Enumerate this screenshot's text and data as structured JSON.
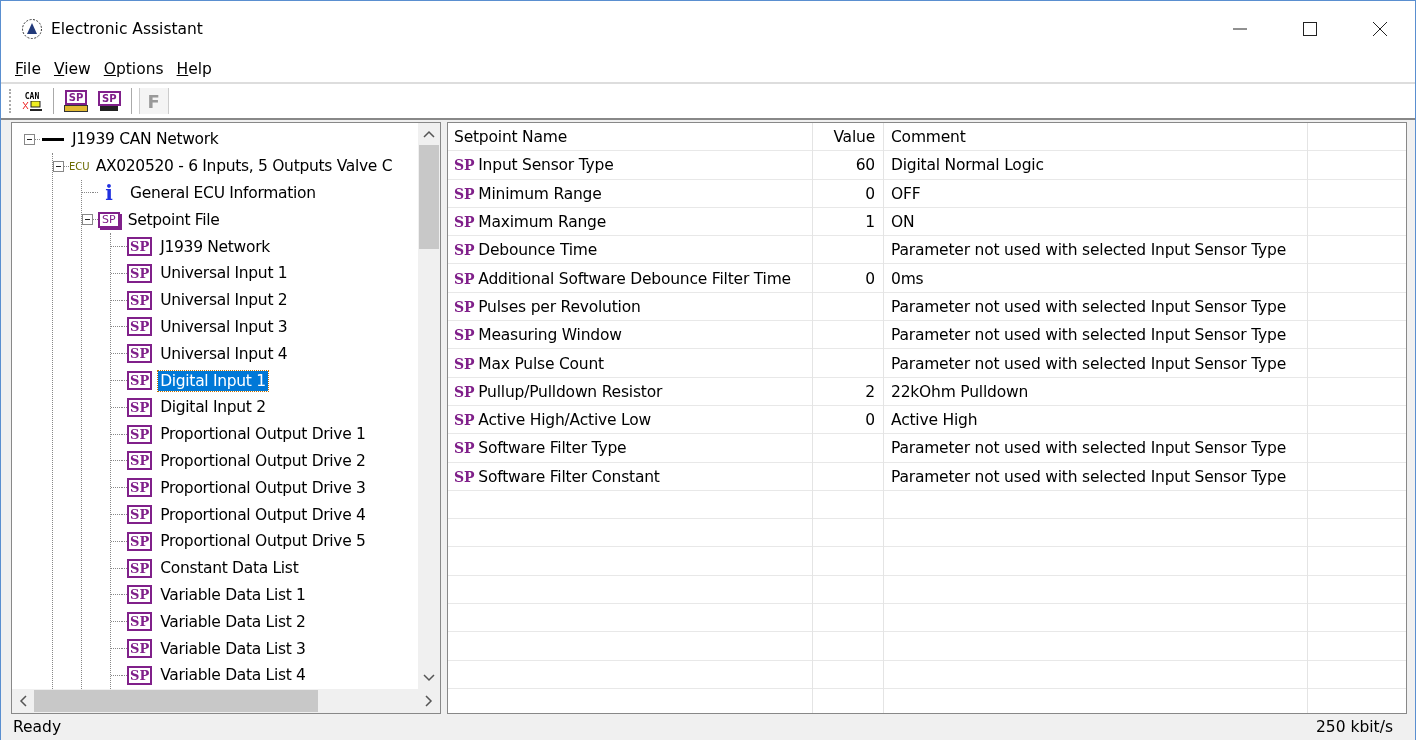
{
  "window": {
    "title": "Electronic Assistant"
  },
  "menu": [
    {
      "label": "File"
    },
    {
      "label": "View"
    },
    {
      "label": "Options"
    },
    {
      "label": "Help"
    }
  ],
  "toolbar": [
    {
      "kind": "can",
      "badge": "CAN"
    },
    {
      "kind": "open",
      "badge": "SP"
    },
    {
      "kind": "save",
      "badge": "SP"
    },
    {
      "kind": "text",
      "label": "F",
      "disabled": true
    }
  ],
  "tree": [
    {
      "label": "J1939 CAN Network",
      "kind": "network",
      "expanded": true,
      "selected": false,
      "children": [
        {
          "label": "AX020520 - 6 Inputs, 5 Outputs Valve C",
          "kind": "ecu",
          "badge": "ECU",
          "expanded": true,
          "selected": false,
          "children": [
            {
              "label": "General ECU Information",
              "kind": "info",
              "badge": "i",
              "selected": false
            },
            {
              "label": "Setpoint File",
              "kind": "file",
              "badge": "SP",
              "expanded": true,
              "selected": false,
              "children": [
                {
                  "label": "J1939 Network",
                  "kind": "setpoint",
                  "badge": "SP",
                  "selected": false
                },
                {
                  "label": "Universal Input 1",
                  "kind": "setpoint",
                  "badge": "SP",
                  "selected": false
                },
                {
                  "label": "Universal Input 2",
                  "kind": "setpoint",
                  "badge": "SP",
                  "selected": false
                },
                {
                  "label": "Universal Input 3",
                  "kind": "setpoint",
                  "badge": "SP",
                  "selected": false
                },
                {
                  "label": "Universal Input 4",
                  "kind": "setpoint",
                  "badge": "SP",
                  "selected": false
                },
                {
                  "label": "Digital Input 1",
                  "kind": "setpoint",
                  "badge": "SP",
                  "selected": true
                },
                {
                  "label": "Digital Input 2",
                  "kind": "setpoint",
                  "badge": "SP",
                  "selected": false
                },
                {
                  "label": "Proportional Output Drive 1",
                  "kind": "setpoint",
                  "badge": "SP",
                  "selected": false
                },
                {
                  "label": "Proportional Output Drive 2",
                  "kind": "setpoint",
                  "badge": "SP",
                  "selected": false
                },
                {
                  "label": "Proportional Output Drive 3",
                  "kind": "setpoint",
                  "badge": "SP",
                  "selected": false
                },
                {
                  "label": "Proportional Output Drive 4",
                  "kind": "setpoint",
                  "badge": "SP",
                  "selected": false
                },
                {
                  "label": "Proportional Output Drive 5",
                  "kind": "setpoint",
                  "badge": "SP",
                  "selected": false
                },
                {
                  "label": "Constant Data List",
                  "kind": "setpoint",
                  "badge": "SP",
                  "selected": false
                },
                {
                  "label": "Variable Data List 1",
                  "kind": "setpoint",
                  "badge": "SP",
                  "selected": false
                },
                {
                  "label": "Variable Data List 2",
                  "kind": "setpoint",
                  "badge": "SP",
                  "selected": false
                },
                {
                  "label": "Variable Data List 3",
                  "kind": "setpoint",
                  "badge": "SP",
                  "selected": false
                },
                {
                  "label": "Variable Data List 4",
                  "kind": "setpoint",
                  "badge": "SP",
                  "selected": false
                }
              ]
            }
          ]
        }
      ]
    }
  ],
  "table": {
    "columns": [
      "Setpoint Name",
      "Value",
      "Comment"
    ],
    "rows": [
      {
        "badge": "SP",
        "name": "Input Sensor Type",
        "value": "60",
        "comment": "Digital Normal Logic"
      },
      {
        "badge": "SP",
        "name": "Minimum Range",
        "value": "0",
        "comment": "OFF"
      },
      {
        "badge": "SP",
        "name": "Maximum Range",
        "value": "1",
        "comment": "ON"
      },
      {
        "badge": "SP",
        "name": "Debounce Time",
        "comment": "Parameter not used with selected Input Sensor Type"
      },
      {
        "badge": "SP",
        "name": "Additional Software Debounce Filter Time",
        "value": "0",
        "comment": "0ms"
      },
      {
        "badge": "SP",
        "name": "Pulses per Revolution",
        "comment": "Parameter not used with selected Input Sensor Type"
      },
      {
        "badge": "SP",
        "name": "Measuring Window",
        "comment": "Parameter not used with selected Input Sensor Type"
      },
      {
        "badge": "SP",
        "name": "Max Pulse Count",
        "comment": "Parameter not used with selected Input Sensor Type"
      },
      {
        "badge": "SP",
        "name": "Pullup/Pulldown Resistor",
        "value": "2",
        "comment": "22kOhm Pulldown"
      },
      {
        "badge": "SP",
        "name": "Active High/Active Low",
        "value": "0",
        "comment": "Active High"
      },
      {
        "badge": "SP",
        "name": "Software Filter Type",
        "comment": "Parameter not used with selected Input Sensor Type"
      },
      {
        "badge": "SP",
        "name": "Software Filter Constant",
        "comment": "Parameter not used with selected Input Sensor Type"
      }
    ]
  },
  "status_bar": {
    "text": "Ready",
    "rate": "250 kbit/s"
  }
}
